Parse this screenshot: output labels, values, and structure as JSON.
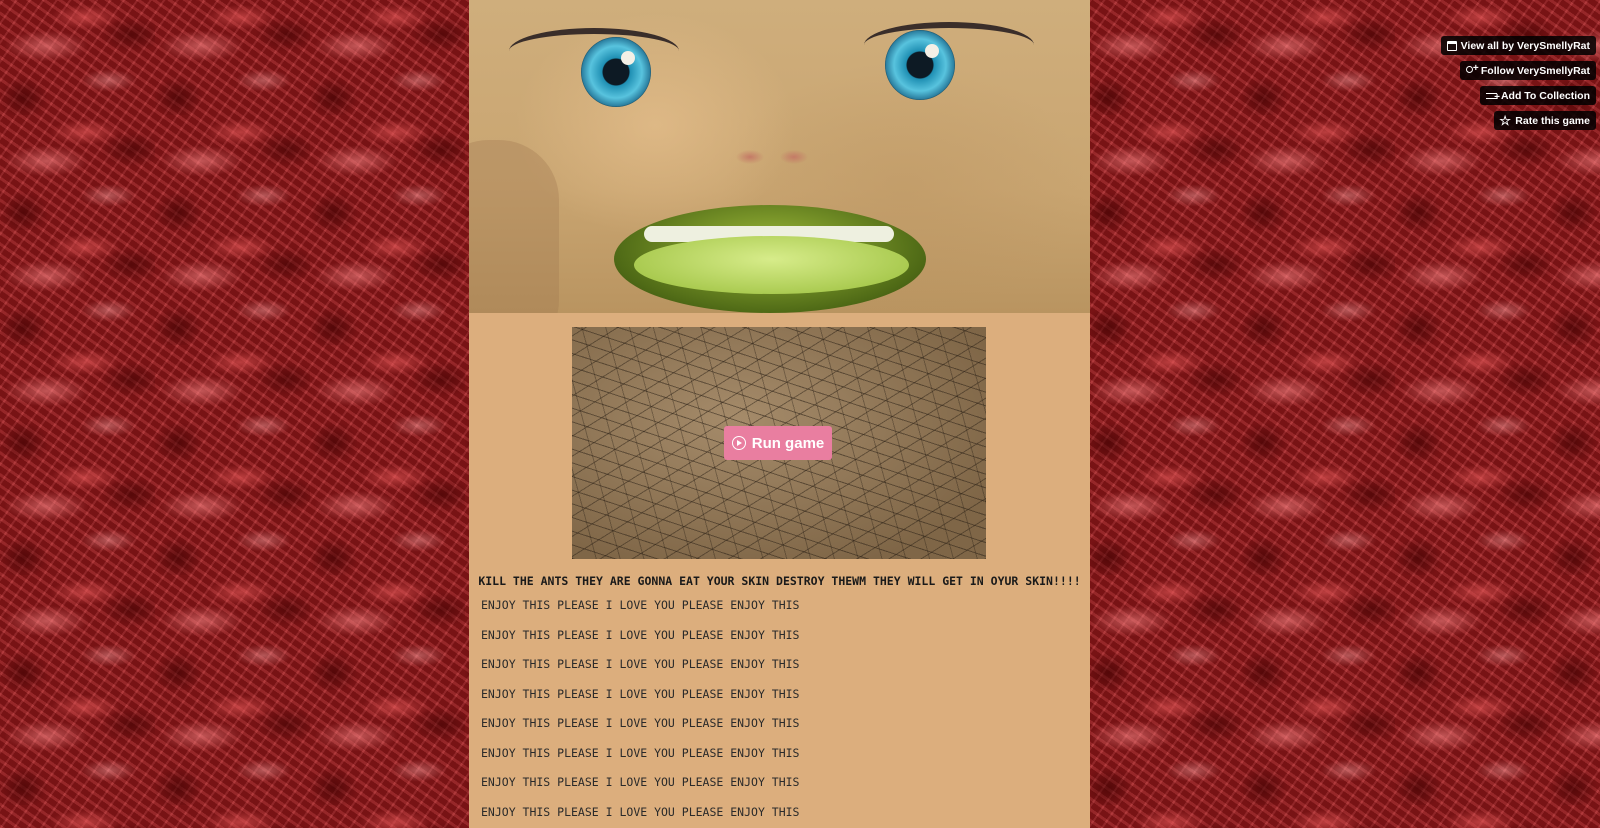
{
  "side_actions": {
    "view_all": "View all by VerySmellyRat",
    "follow": "Follow VerySmellyRat",
    "add_to_collection": "Add To Collection",
    "rate": "Rate this game"
  },
  "player": {
    "run_label": "Run game"
  },
  "description": {
    "headline": "KILL THE ANTS THEY ARE GONNA EAT YOUR SKIN DESTROY THEWM THEY WILL GET IN OYUR SKIN!!!!",
    "lines": [
      "ENJOY THIS PLEASE I LOVE YOU PLEASE ENJOY THIS",
      "ENJOY THIS PLEASE I LOVE YOU PLEASE ENJOY THIS",
      "ENJOY THIS PLEASE I LOVE YOU PLEASE ENJOY THIS",
      "ENJOY THIS PLEASE I LOVE YOU PLEASE ENJOY THIS",
      "ENJOY THIS PLEASE I LOVE YOU PLEASE ENJOY THIS",
      "ENJOY THIS PLEASE I LOVE YOU PLEASE ENJOY THIS",
      "ENJOY THIS PLEASE I LOVE YOU PLEASE ENJOY THIS",
      "ENJOY THIS PLEASE I LOVE YOU PLEASE ENJOY THIS"
    ]
  },
  "colors": {
    "page_background": "#8e1a1d",
    "column_background": "#dcae7d",
    "run_button": "#e97ea0",
    "side_button": "#000000"
  },
  "icons": [
    "store-icon",
    "follow-user-icon",
    "add-to-collection-icon",
    "star-icon",
    "play-circle-icon"
  ]
}
